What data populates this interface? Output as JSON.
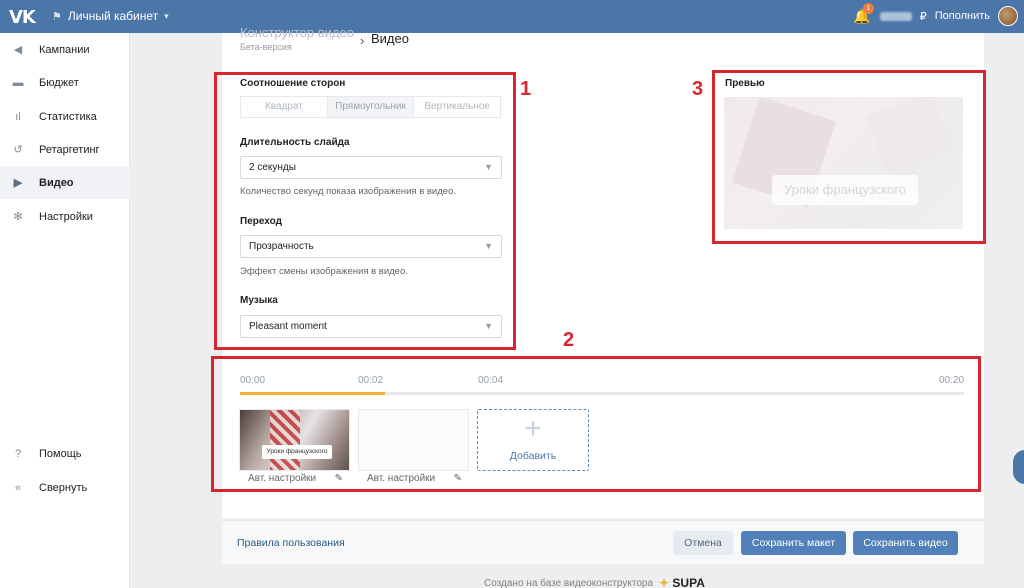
{
  "topbar": {
    "logo": "VK",
    "cabinet_label": "Личный кабинет",
    "notif_count": "1",
    "currency": "₽",
    "topup_label": "Пополнить"
  },
  "sidebar": {
    "items": [
      {
        "label": "Кампании",
        "icon": "megaphone-icon"
      },
      {
        "label": "Бюджет",
        "icon": "wallet-icon"
      },
      {
        "label": "Статистика",
        "icon": "chart-icon"
      },
      {
        "label": "Ретаргетинг",
        "icon": "retarget-icon"
      },
      {
        "label": "Видео",
        "icon": "play-icon"
      },
      {
        "label": "Настройки",
        "icon": "gear-icon"
      }
    ],
    "help_label": "Помощь",
    "collapse_label": "Свернуть"
  },
  "breadcrumb": {
    "parent": "Конструктор видео",
    "parent_sub": "Бета-версия",
    "current": "Видео"
  },
  "settings": {
    "aspect_label": "Соотношение сторон",
    "aspect_options": [
      "Квадрат",
      "Прямоугольник",
      "Вертикальное"
    ],
    "aspect_selected": "Прямоугольник",
    "slide_duration_label": "Длительность слайда",
    "slide_duration_value": "2 секунды",
    "slide_duration_hint": "Количество секунд показа изображения в видео.",
    "transition_label": "Переход",
    "transition_value": "Прозрачность",
    "transition_hint": "Эффект смены изображения в видео.",
    "music_label": "Музыка",
    "music_value": "Pleasant moment"
  },
  "preview": {
    "label": "Превью",
    "caption": "Уроки французского"
  },
  "timeline": {
    "marks": [
      "00:00",
      "00:02",
      "00:04",
      "00:20"
    ],
    "progress_fraction": 0.2
  },
  "slides": [
    {
      "caption": "Уроки французского",
      "footer": "Авт. настройки"
    },
    {
      "caption": "",
      "footer": "Авт. настройки"
    }
  ],
  "add_label": "Добавить",
  "annotations": [
    "1",
    "2",
    "3"
  ],
  "footer": {
    "rules_link": "Правила пользования",
    "cancel_label": "Отмена",
    "save_layout_label": "Сохранить макет",
    "save_video_label": "Сохранить видео"
  },
  "credits": {
    "text": "Создано на базе видеоконструктора",
    "brand": "SUPA"
  },
  "colors": {
    "topbar": "#4a76a8",
    "accent": "#5181b8",
    "timeline_fill": "#f0b23b",
    "annotation": "#d7262e"
  }
}
